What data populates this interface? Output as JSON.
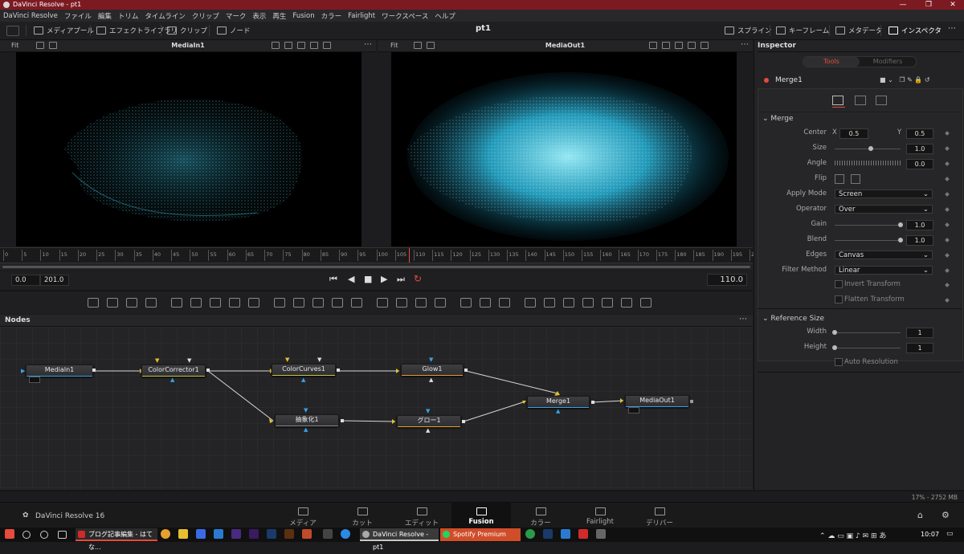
{
  "window": {
    "title": "DaVinci Resolve - pt1"
  },
  "menu": [
    "DaVinci Resolve",
    "ファイル",
    "編集",
    "トリム",
    "タイムライン",
    "クリップ",
    "マーク",
    "表示",
    "再生",
    "Fusion",
    "カラー",
    "Fairlight",
    "ワークスペース",
    "ヘルプ"
  ],
  "toolbar": {
    "media_pool": "メディアプール",
    "effects_library": "エフェクトライブラリ",
    "clip": "クリップ",
    "nodes": "ノード",
    "project_title": "pt1",
    "spline": "スプライン",
    "keyframes": "キーフレーム",
    "metadata": "メタデータ",
    "inspector": "インスペクタ"
  },
  "viewer_left": {
    "fit": "Fit",
    "name": "MediaIn1"
  },
  "viewer_right": {
    "fit": "Fit",
    "name": "MediaOut1"
  },
  "ruler_ticks": [
    "0",
    "5",
    "10",
    "15",
    "20",
    "25",
    "30",
    "35",
    "40",
    "45",
    "50",
    "55",
    "60",
    "65",
    "70",
    "75",
    "80",
    "85",
    "90",
    "95",
    "100",
    "105",
    "110",
    "115",
    "120",
    "125",
    "130",
    "135",
    "140",
    "145",
    "150",
    "155",
    "160",
    "165",
    "170",
    "175",
    "180",
    "185",
    "190",
    "195",
    "20"
  ],
  "transport": {
    "start": "0.0",
    "end": "201.0",
    "current": "110.0"
  },
  "nodes_panel": {
    "title": "Nodes"
  },
  "nodes": [
    {
      "id": "mediain",
      "label": "MediaIn1"
    },
    {
      "id": "cc",
      "label": "ColorCorrector1"
    },
    {
      "id": "curves",
      "label": "ColorCurves1"
    },
    {
      "id": "glow1",
      "label": "Glow1"
    },
    {
      "id": "abstract",
      "label": "抽象化1"
    },
    {
      "id": "glow_jp",
      "label": "グロー1"
    },
    {
      "id": "merge",
      "label": "Merge1"
    },
    {
      "id": "mediaout",
      "label": "MediaOut1"
    }
  ],
  "inspector": {
    "title": "Inspector",
    "tabs": [
      "Tools",
      "Modifiers"
    ],
    "tool_name": "Merge1",
    "section_merge": "Merge",
    "center_label": "Center",
    "center_x_label": "X",
    "center_x": "0.5",
    "center_y_label": "Y",
    "center_y": "0.5",
    "size_label": "Size",
    "size": "1.0",
    "angle_label": "Angle",
    "angle": "0.0",
    "flip_label": "Flip",
    "apply_mode_label": "Apply Mode",
    "apply_mode": "Screen",
    "operator_label": "Operator",
    "operator": "Over",
    "gain_label": "Gain",
    "gain": "1.0",
    "blend_label": "Blend",
    "blend": "1.0",
    "edges_label": "Edges",
    "edges": "Canvas",
    "filter_label": "Filter Method",
    "filter": "Linear",
    "invert_transform": "Invert Transform",
    "flatten_transform": "Flatten Transform",
    "section_ref": "Reference Size",
    "width_label": "Width",
    "width": "1",
    "height_label": "Height",
    "height": "1",
    "auto_resolution": "Auto Resolution",
    "size_fraction": 0.55,
    "gain_fraction": 1.0,
    "blend_fraction": 1.0
  },
  "status": {
    "memory": "17% - 2752 MB"
  },
  "brand": {
    "name": "DaVinci Resolve 16"
  },
  "pages": [
    "メディア",
    "カット",
    "エディット",
    "Fusion",
    "カラー",
    "Fairlight",
    "デリバー"
  ],
  "active_page": "Fusion",
  "taskbar": {
    "app1": "ブログ記事編集 - はてな...",
    "app2": "DaVinci Resolve - pt1",
    "app3": "Spotify Premium",
    "clock": "10:07"
  },
  "colors": {
    "accent": "#e64b3c",
    "title_bar": "#7c1a22",
    "spotify": "#d04d2a",
    "node_yellow": "#c8c840",
    "node_blue": "#3aa0e6",
    "node_orange": "#e6a030"
  }
}
